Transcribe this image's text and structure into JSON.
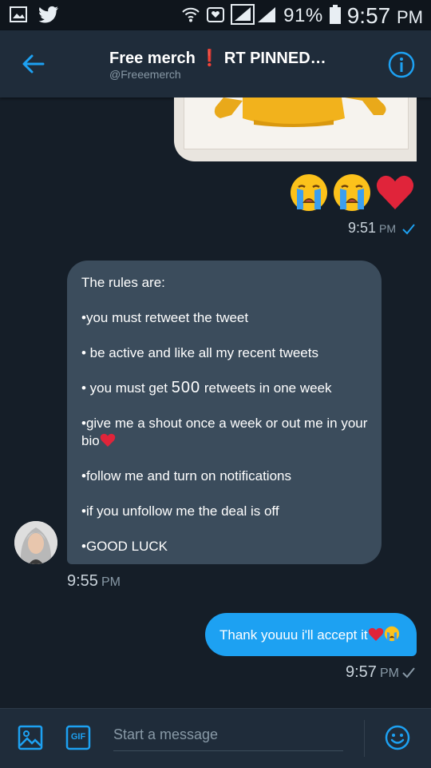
{
  "status_bar": {
    "battery_percent": "91%",
    "time": "9:57",
    "ampm": "PM"
  },
  "header": {
    "title_part1": "Free merch",
    "title_excl": "❗",
    "title_part2": "RT PINNED…",
    "handle": "@Freeemerch"
  },
  "messages": {
    "sent_emojis_time": "9:51",
    "received_rules": [
      "The rules are:",
      "•you must retweet the tweet",
      "• be active and like all my recent tweets",
      "• you must get 500 retweets in one week",
      "•give me a shout once a week or out me in your bio",
      "•follow me and turn on notifications",
      "•if you unfollow me the deal is off",
      "•GOOD LUCK"
    ],
    "rule4_prefix": "• you must get ",
    "rule4_number": "500",
    "rule4_suffix": " retweets in one week",
    "rule5_line1": "•give me a shout once a week or out me in your",
    "rule5_line2": "bio",
    "received_time": "9:55",
    "sent_reply": "Thank youuu i'll accept it",
    "sent_reply_time": "9:57",
    "ampm": "PM"
  },
  "composer": {
    "placeholder": "Start a message",
    "gif_label": "GIF"
  },
  "colors": {
    "background": "#151e28",
    "header": "#1f2c3a",
    "accent_blue": "#1da1f2",
    "received_bubble": "#3b4c5c"
  },
  "icons": [
    "picture-icon",
    "twitter-bird-icon",
    "wifi-icon",
    "voicemail-icon",
    "signal-icon",
    "battery-icon",
    "back-arrow-icon",
    "info-icon",
    "crying-face-emoji",
    "red-heart-emoji",
    "check-icon",
    "image-icon",
    "gif-icon",
    "smiley-icon"
  ]
}
